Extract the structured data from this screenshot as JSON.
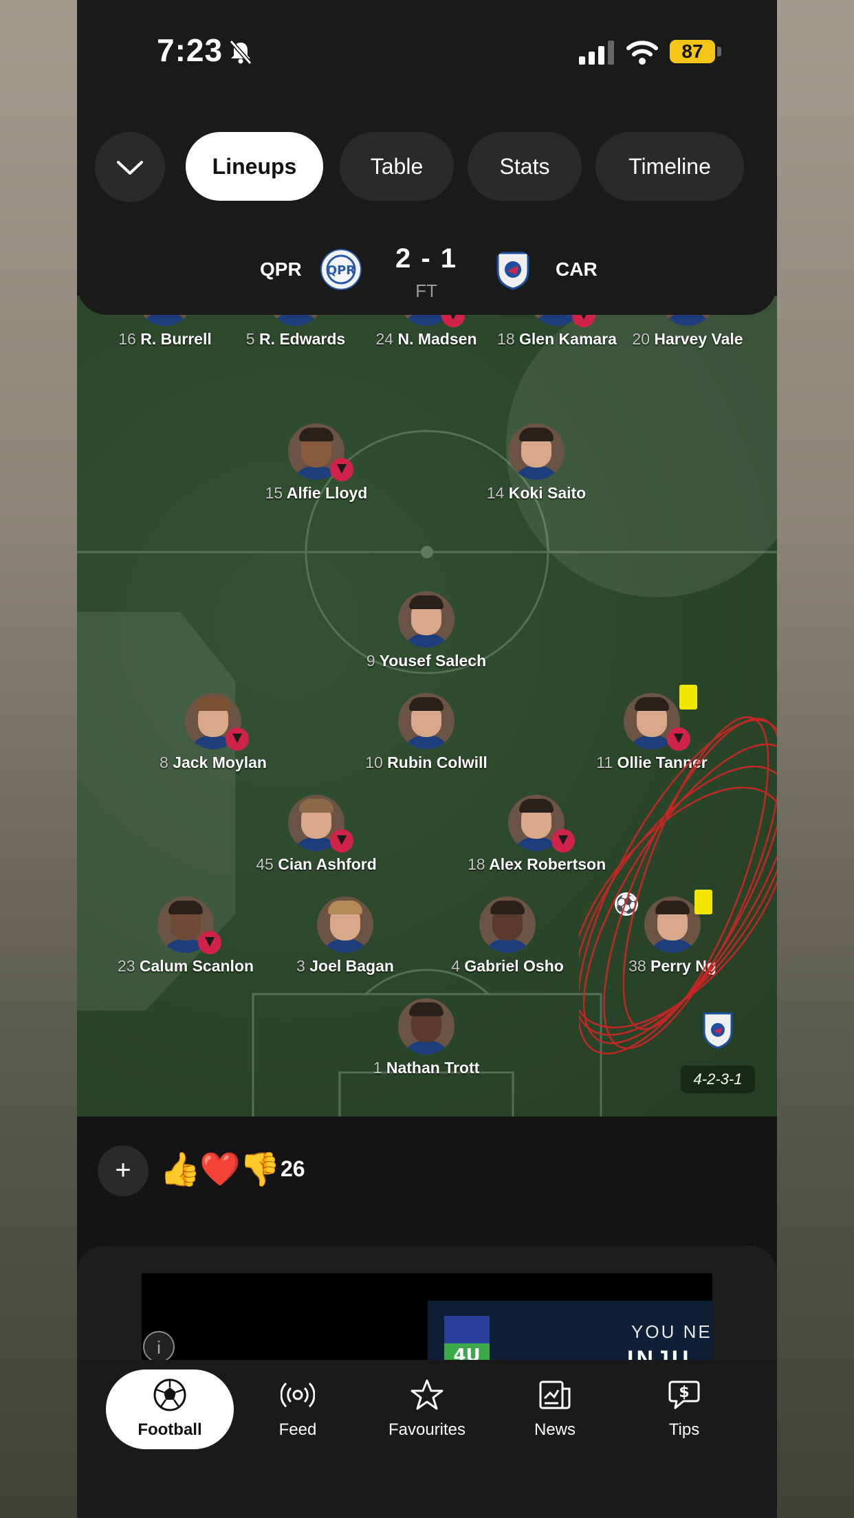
{
  "status_bar": {
    "time": "7:23",
    "battery": "87"
  },
  "tabs": [
    {
      "label": "Lineups",
      "active": true
    },
    {
      "label": "Table",
      "active": false
    },
    {
      "label": "Stats",
      "active": false
    },
    {
      "label": "Timeline",
      "active": false
    }
  ],
  "match": {
    "home_abbr": "QPR",
    "away_abbr": "CAR",
    "score": "2 - 1",
    "status": "FT"
  },
  "players": [
    {
      "num": "16",
      "name": "R. Burrell",
      "sub": false
    },
    {
      "num": "5",
      "name": "R. Edwards",
      "sub": false
    },
    {
      "num": "24",
      "name": "N. Madsen",
      "sub": true
    },
    {
      "num": "18",
      "name": "Glen Kamara",
      "sub": true
    },
    {
      "num": "20",
      "name": "Harvey Vale",
      "sub": false
    },
    {
      "num": "15",
      "name": "Alfie Lloyd",
      "sub": true
    },
    {
      "num": "14",
      "name": "Koki Saito",
      "sub": false
    },
    {
      "num": "9",
      "name": "Yousef Salech",
      "sub": false
    },
    {
      "num": "8",
      "name": "Jack Moylan",
      "sub": true
    },
    {
      "num": "10",
      "name": "Rubin Colwill",
      "sub": false
    },
    {
      "num": "11",
      "name": "Ollie Tanner",
      "sub": true,
      "yellow": true
    },
    {
      "num": "45",
      "name": "Cian Ashford",
      "sub": true
    },
    {
      "num": "18",
      "name": "Alex Robertson",
      "sub": true
    },
    {
      "num": "23",
      "name": "Calum Scanlon",
      "sub": true
    },
    {
      "num": "3",
      "name": "Joel Bagan",
      "sub": false
    },
    {
      "num": "4",
      "name": "Gabriel Osho",
      "sub": false
    },
    {
      "num": "38",
      "name": "Perry Ng",
      "sub": false,
      "yellow": true,
      "goal": true
    },
    {
      "num": "1",
      "name": "Nathan Trott",
      "sub": false
    }
  ],
  "formation": "4-2-3-1",
  "reactions": {
    "add_label": "+",
    "emojis": [
      "👍",
      "❤️",
      "👎"
    ],
    "count": "26"
  },
  "ad": {
    "info": "i",
    "line1": "YOU NE",
    "line2": "INJU"
  },
  "nav": [
    {
      "label": "Football",
      "icon": "football-icon",
      "active": true
    },
    {
      "label": "Feed",
      "icon": "feed-icon",
      "active": false
    },
    {
      "label": "Favourites",
      "icon": "star-icon",
      "active": false
    },
    {
      "label": "News",
      "icon": "news-icon",
      "active": false
    },
    {
      "label": "Tips",
      "icon": "tips-icon",
      "active": false
    }
  ],
  "colors": {
    "pitch": "#2c4a2c",
    "sub_badge": "#d0234a",
    "yellow_card": "#f2e600",
    "annotation": "#d42424"
  }
}
